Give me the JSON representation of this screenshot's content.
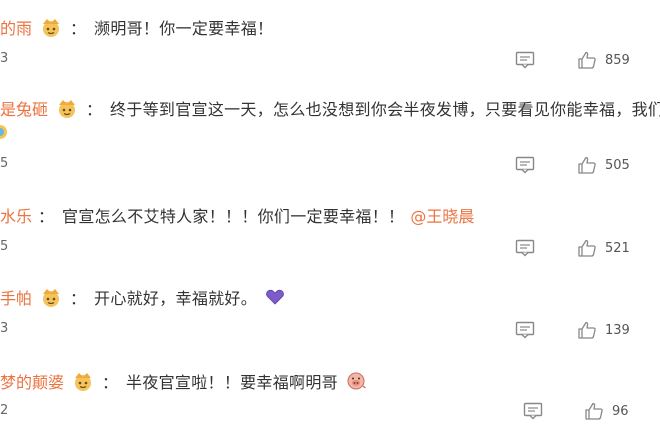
{
  "comments": [
    {
      "user": "的雨",
      "colon": "：",
      "text": "濒明哥！你一定要幸福！",
      "meta": "3",
      "likes": "859"
    },
    {
      "user": "是兔砸",
      "colon": "：",
      "text": "终于等到官宣这一天，怎么也没想到你会半夜发博，只要看见你能幸福，我们也",
      "meta": "5",
      "likes": "505"
    },
    {
      "user": "水乐",
      "colon": "：",
      "text": "官宣怎么不艾特人家！！！你们一定要幸福！！",
      "mention": "@王晓晨",
      "meta": "5",
      "likes": "521"
    },
    {
      "user": "手帕",
      "colon": "：",
      "text": "开心就好，幸福就好。",
      "meta": "3",
      "likes": "139"
    },
    {
      "user": "梦的颠婆",
      "colon": "：",
      "text": "半夜官宣啦！！要幸福啊明哥",
      "meta": "2",
      "likes": "96"
    }
  ],
  "icons": {
    "badge": "crown-badge-icon",
    "reply": "comment-icon",
    "like": "thumbs-up-icon",
    "heart": "purple-heart-emoji",
    "pig": "pig-face-emoji"
  },
  "colors": {
    "username": "#eb7340",
    "text": "#333333",
    "icon": "#888888",
    "heart": "#7b5cc9"
  }
}
